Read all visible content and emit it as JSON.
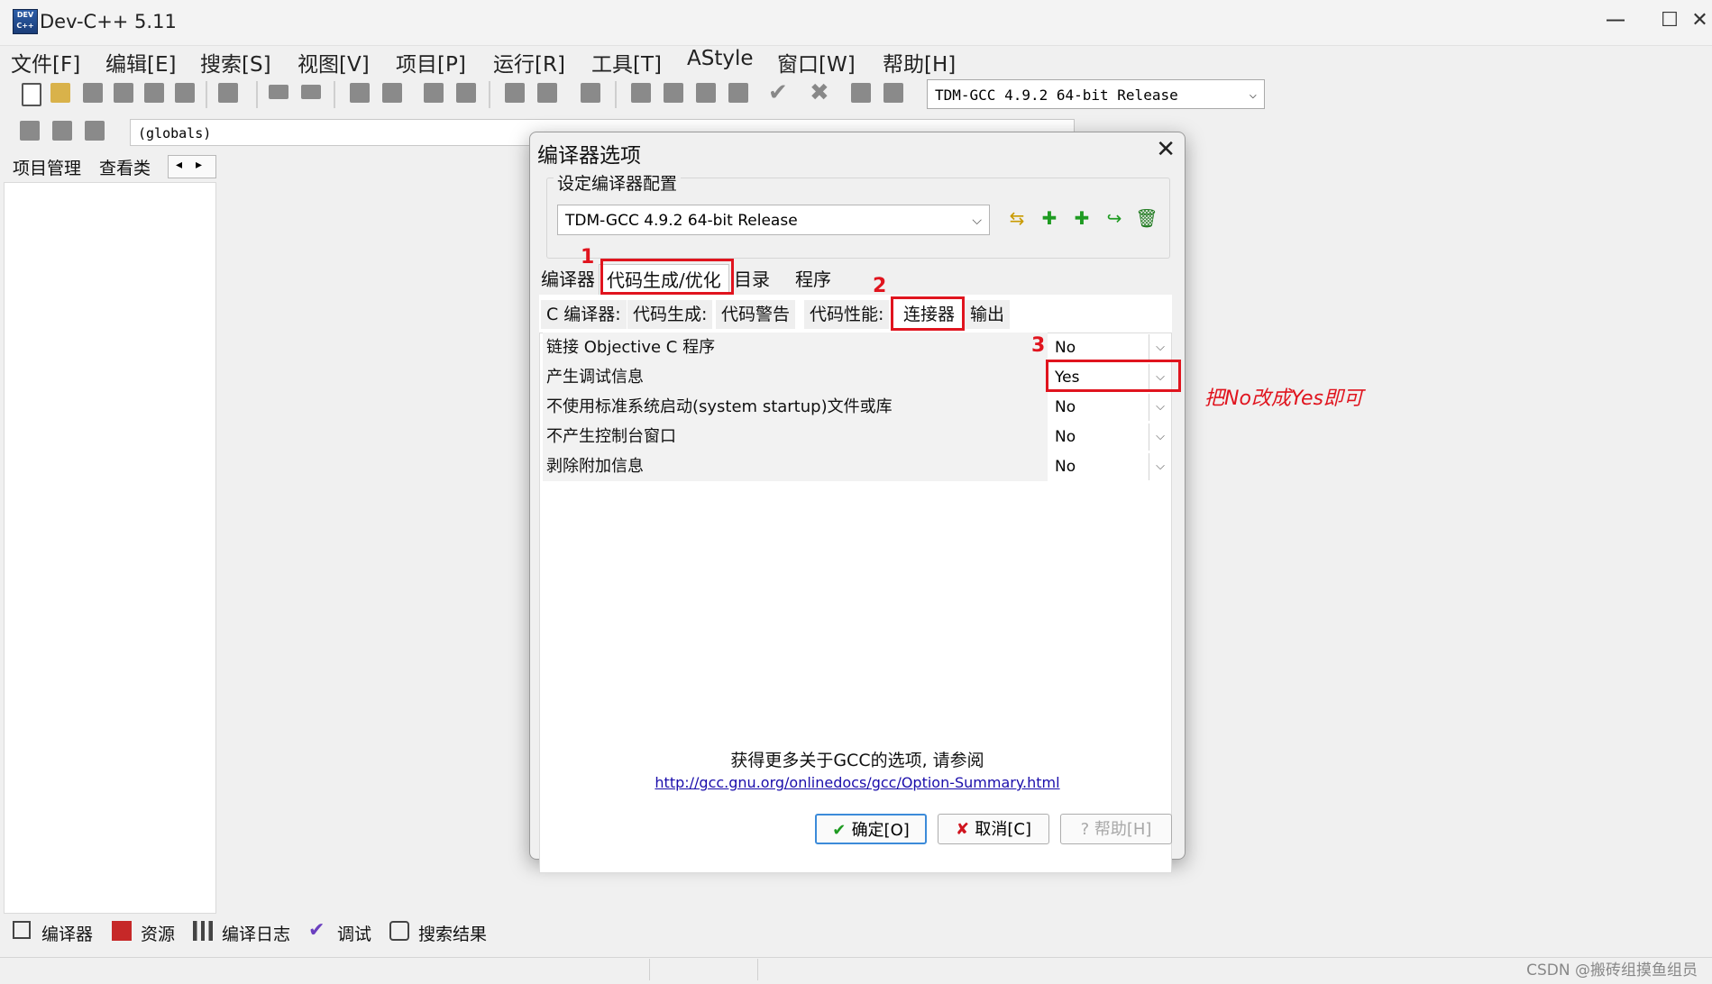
{
  "window": {
    "title": "Dev-C++ 5.11",
    "controls": {
      "minimize": "—",
      "maximize": "☐",
      "close": "✕"
    }
  },
  "menu": [
    "文件[F]",
    "编辑[E]",
    "搜索[S]",
    "视图[V]",
    "项目[P]",
    "运行[R]",
    "工具[T]",
    "AStyle",
    "窗口[W]",
    "帮助[H]"
  ],
  "toolbar": {
    "compiler_select": "TDM-GCC 4.9.2 64-bit Release",
    "scope_select": "(globals)"
  },
  "left_tabs": [
    "项目管理",
    "查看类"
  ],
  "bottom_tabs": [
    "编译器",
    "资源",
    "编译日志",
    "调试",
    "搜索结果"
  ],
  "watermark": "CSDN @搬砖组摸鱼组员",
  "dialog": {
    "title": "编译器选项",
    "group_label": "设定编译器配置",
    "config_select": "TDM-GCC 4.9.2 64-bit Release",
    "main_tabs": [
      "编译器",
      "代码生成/优化",
      "目录",
      "程序"
    ],
    "sub_tabs": [
      "C 编译器:",
      "代码生成:",
      "代码警告",
      "代码性能:",
      "连接器",
      "输出"
    ],
    "rows": [
      {
        "label": "链接 Objective C 程序",
        "value": "No"
      },
      {
        "label": "产生调试信息",
        "value": "Yes"
      },
      {
        "label": "不使用标准系统启动(system startup)文件或库",
        "value": "No"
      },
      {
        "label": "不产生控制台窗口",
        "value": "No"
      },
      {
        "label": "剥除附加信息",
        "value": "No"
      }
    ],
    "info_text": "获得更多关于GCC的选项, 请参阅",
    "link": "http://gcc.gnu.org/onlinedocs/gcc/Option-Summary.html",
    "buttons": {
      "ok": "确定[O]",
      "cancel": "取消[C]",
      "help": "帮助[H]"
    }
  },
  "annotations": {
    "num1": "1",
    "num2": "2",
    "num3": "3",
    "note": "把No改成Yes即可",
    "color": "#e0141e"
  }
}
